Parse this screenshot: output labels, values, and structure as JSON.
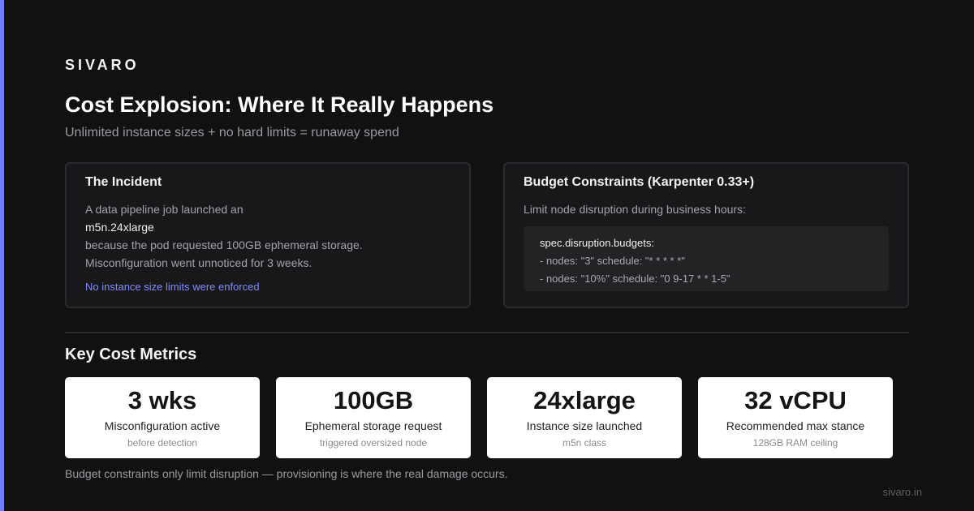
{
  "brand": "SIVARO",
  "title": "Cost Explosion: Where It Really Happens",
  "subtitle": "Unlimited instance sizes + no hard limits = runaway spend",
  "incident": {
    "title": "The Incident",
    "lines": [
      "A data pipeline job launched an",
      "m5n.24xlarge",
      "because the pod requested 100GB ephemeral storage.",
      "Misconfiguration went unnoticed for 3 weeks."
    ],
    "note": "No instance size limits were enforced"
  },
  "budget": {
    "title": "Budget Constraints (Karpenter 0.33+)",
    "description": "Limit node disruption during business hours:",
    "code": [
      "spec.disruption.budgets:",
      "- nodes: \"3\" schedule: \"* * * * *\"",
      "- nodes: \"10%\" schedule: \"0 9-17 * * 1-5\""
    ]
  },
  "metrics_section": {
    "title": "Key Cost Metrics",
    "items": [
      {
        "value": "3 wks",
        "label": "Misconfiguration active",
        "sub": "before detection"
      },
      {
        "value": "100GB",
        "label": "Ephemeral storage request",
        "sub": "triggered oversized node"
      },
      {
        "value": "24xlarge",
        "label": "Instance size launched",
        "sub": "m5n class"
      },
      {
        "value": "32 vCPU",
        "label": "Recommended max stance",
        "sub": "128GB RAM ceiling"
      }
    ]
  },
  "footer": {
    "note": "Budget constraints only limit disruption — provisioning is where the real damage occurs.",
    "brand": "sivaro.in"
  },
  "colors": {
    "background": "#111112",
    "accent": "#6f7dff",
    "card": "#18181a",
    "metric_card": "#ffffff"
  }
}
